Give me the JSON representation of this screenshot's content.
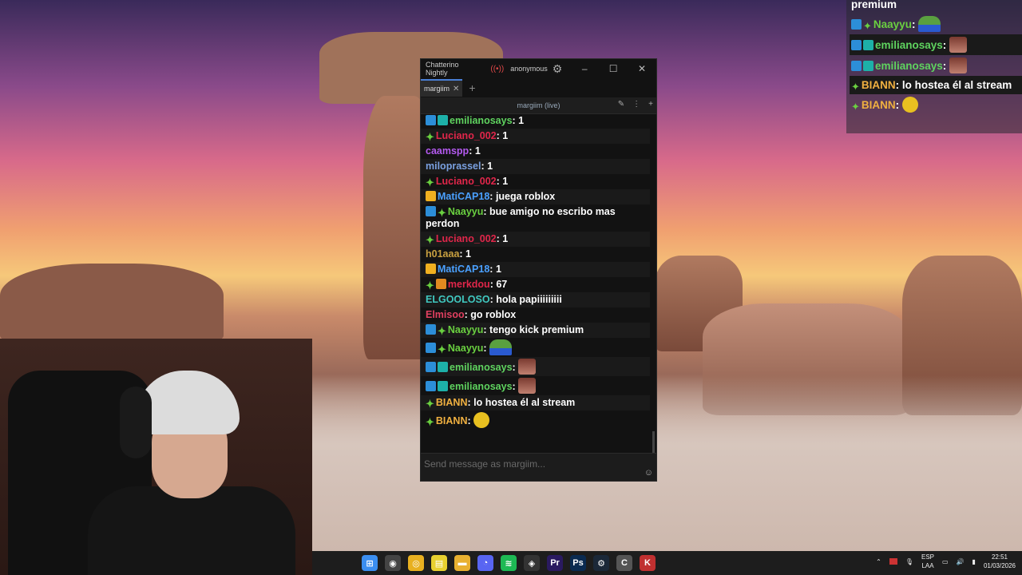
{
  "window": {
    "title": "Chatterino Nightly",
    "user": "anonymous",
    "tab_label": "margiim",
    "split_title": "margiim (live)",
    "input_placeholder": "Send message as margiim..."
  },
  "messages": [
    {
      "name": "emilianosays",
      "color": "#5fd35f",
      "text": "1",
      "badges": [
        "mod",
        "sub"
      ]
    },
    {
      "name": "Luciano_002",
      "color": "#e0264a",
      "text": "1",
      "badges": [
        "sparkle"
      ]
    },
    {
      "name": "caamspp",
      "color": "#b45af0",
      "text": "1",
      "badges": []
    },
    {
      "name": "miloprassel",
      "color": "#7aa0e0",
      "text": "1",
      "badges": []
    },
    {
      "name": "Luciano_002",
      "color": "#e0264a",
      "text": "1",
      "badges": [
        "sparkle"
      ]
    },
    {
      "name": "MatiCAP18",
      "color": "#4aa0ff",
      "text": "juega roblox",
      "badges": [
        "vip"
      ]
    },
    {
      "name": "Naayyu",
      "color": "#6ad040",
      "text": "bue amigo no escribo mas perdon",
      "badges": [
        "mod",
        "sparkle"
      ]
    },
    {
      "name": "Luciano_002",
      "color": "#e0264a",
      "text": "1",
      "badges": [
        "sparkle"
      ]
    },
    {
      "name": "h01aaa",
      "color": "#c8a040",
      "text": "1",
      "badges": []
    },
    {
      "name": "MatiCAP18",
      "color": "#4aa0ff",
      "text": "1",
      "badges": [
        "vip"
      ]
    },
    {
      "name": "merkdou",
      "color": "#e0264a",
      "text": "67",
      "badges": [
        "sparkle",
        "box"
      ]
    },
    {
      "name": "ELGOOLOSO",
      "color": "#40c8c0",
      "text": "hola papiiiiiiiii",
      "badges": []
    },
    {
      "name": "Elmisoo",
      "color": "#e04060",
      "text": "go roblox",
      "badges": []
    },
    {
      "name": "Naayyu",
      "color": "#6ad040",
      "text": "tengo kick premium",
      "badges": [
        "mod",
        "sparkle"
      ]
    },
    {
      "name": "Naayyu",
      "color": "#6ad040",
      "text": "",
      "emote": "pepe",
      "badges": [
        "mod",
        "sparkle"
      ]
    },
    {
      "name": "emilianosays",
      "color": "#5fd35f",
      "text": "",
      "emote": "face",
      "badges": [
        "mod",
        "sub"
      ]
    },
    {
      "name": "emilianosays",
      "color": "#5fd35f",
      "text": "",
      "emote": "face",
      "badges": [
        "mod",
        "sub"
      ]
    },
    {
      "name": "BIANN",
      "color": "#f0b040",
      "text": "lo hostea él al stream",
      "badges": [
        "sparkle"
      ]
    },
    {
      "name": "BIANN",
      "color": "#f0b040",
      "text": "",
      "emote": "yellow",
      "badges": [
        "sparkle"
      ]
    }
  ],
  "overlay": {
    "top_text": "premium",
    "messages": [
      {
        "name": "Naayyu",
        "color": "#6ad040",
        "text": "",
        "emote": "pepe",
        "badges": [
          "mod",
          "sparkle"
        ]
      },
      {
        "name": "emilianosays",
        "color": "#5fd35f",
        "text": "",
        "emote": "face",
        "badges": [
          "mod",
          "sub"
        ]
      },
      {
        "name": "emilianosays",
        "color": "#5fd35f",
        "text": "",
        "emote": "face",
        "badges": [
          "mod",
          "sub"
        ]
      },
      {
        "name": "BIANN",
        "color": "#f0b040",
        "text": "lo hostea él al stream",
        "badges": [
          "sparkle"
        ]
      },
      {
        "name": "BIANN",
        "color": "#f0b040",
        "text": "",
        "emote": "yellow",
        "badges": [
          "sparkle"
        ]
      }
    ]
  },
  "taskbar": {
    "apps": [
      "start",
      "obs",
      "chrome",
      "notes",
      "files",
      "discord",
      "spotify",
      "app",
      "premiere",
      "photoshop",
      "steam",
      "chatterino",
      "kick"
    ],
    "lang_top": "ESP",
    "lang_bottom": "LAA",
    "time": "22:51",
    "date": "01/03/2026"
  }
}
